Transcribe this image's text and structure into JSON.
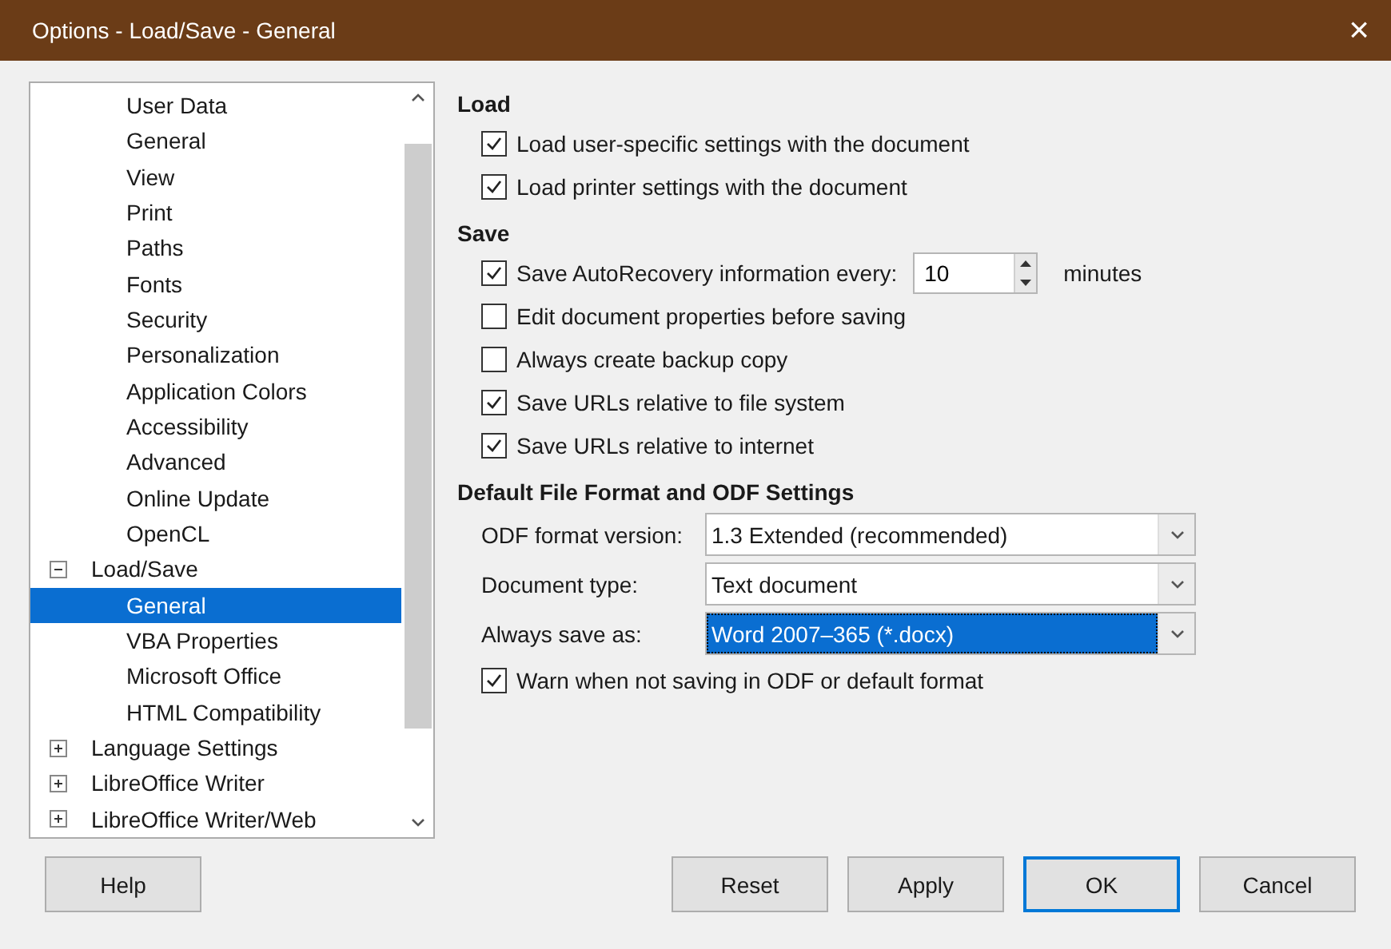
{
  "window": {
    "title": "Options - Load/Save - General",
    "close": "×"
  },
  "tree": {
    "items": [
      {
        "children": [
          {
            "label": "User Data",
            "selected": false
          },
          {
            "label": "General",
            "selected": false
          },
          {
            "label": "View",
            "selected": false
          },
          {
            "label": "Print",
            "selected": false
          },
          {
            "label": "Paths",
            "selected": false
          },
          {
            "label": "Fonts",
            "selected": false
          },
          {
            "label": "Security",
            "selected": false
          },
          {
            "label": "Personalization",
            "selected": false
          },
          {
            "label": "Application Colors",
            "selected": false
          },
          {
            "label": "Accessibility",
            "selected": false
          },
          {
            "label": "Advanced",
            "selected": false
          },
          {
            "label": "Online Update",
            "selected": false
          },
          {
            "label": "OpenCL",
            "selected": false
          }
        ]
      },
      {
        "label": "Load/Save",
        "expanded": true,
        "selected": false,
        "children": [
          {
            "label": "General",
            "selected": true
          },
          {
            "label": "VBA Properties",
            "selected": false
          },
          {
            "label": "Microsoft Office",
            "selected": false
          },
          {
            "label": "HTML Compatibility",
            "selected": false
          }
        ]
      },
      {
        "label": "Language Settings",
        "expanded": false,
        "selected": false
      },
      {
        "label": "LibreOffice Writer",
        "expanded": false,
        "selected": false
      },
      {
        "label": "LibreOffice Writer/Web",
        "expanded": false,
        "selected": false
      }
    ]
  },
  "sections": [
    {
      "title": "Load",
      "rows": [
        {
          "kind": "checkbox",
          "label": "Load user-specific settings with the document",
          "checked": true
        },
        {
          "kind": "checkbox",
          "label": "Load printer settings with the document",
          "checked": true
        }
      ]
    },
    {
      "title": "Save",
      "rows": [
        {
          "kind": "spin",
          "label": "Save AutoRecovery information every:",
          "checked": true,
          "value": "10",
          "unit": "minutes"
        },
        {
          "kind": "checkbox",
          "label": "Edit document properties before saving",
          "checked": false
        },
        {
          "kind": "checkbox",
          "label": "Always create backup copy",
          "checked": false
        },
        {
          "kind": "checkbox",
          "label": "Save URLs relative to file system",
          "checked": true
        },
        {
          "kind": "checkbox",
          "label": "Save URLs relative to internet",
          "checked": true
        }
      ]
    },
    {
      "title": "Default File Format and ODF Settings",
      "rows": [
        {
          "kind": "select",
          "label": "ODF format version:",
          "value": "1.3 Extended (recommended)",
          "focused": false
        },
        {
          "kind": "select",
          "label": "Document type:",
          "value": "Text document",
          "focused": false
        },
        {
          "kind": "select",
          "label": "Always save as:",
          "value": "Word 2007–365 (*.docx)",
          "focused": true
        },
        {
          "kind": "checkbox",
          "label": "Warn when not saving in ODF or default format",
          "checked": true
        }
      ]
    }
  ],
  "buttons": [
    {
      "label": "Help",
      "default": false
    },
    {
      "label": "Reset",
      "default": false
    },
    {
      "label": "Apply",
      "default": false
    },
    {
      "label": "OK",
      "default": true
    },
    {
      "label": "Cancel",
      "default": false
    }
  ]
}
